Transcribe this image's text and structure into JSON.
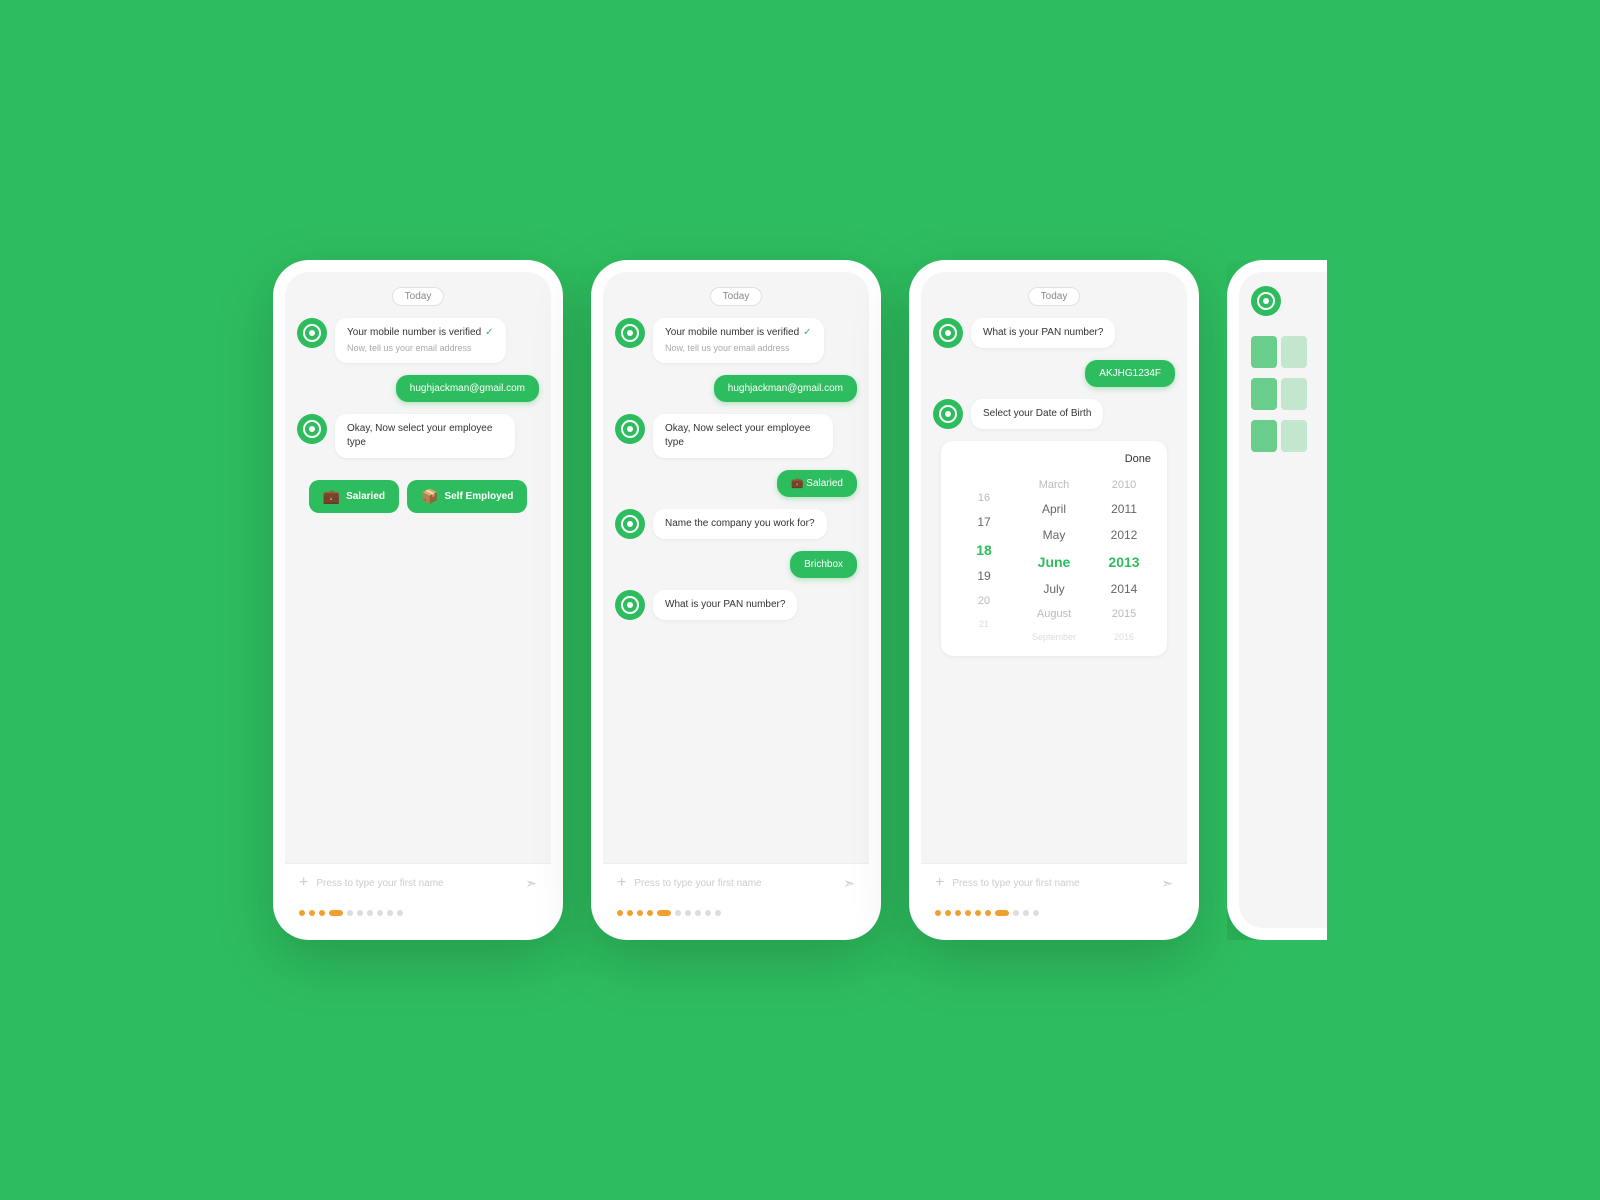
{
  "background_color": "#2EBD5E",
  "phones": [
    {
      "id": "phone-1",
      "today_label": "Today",
      "messages": [
        {
          "type": "bot",
          "text": "Your mobile number is verified",
          "subtext": "Now, tell us your email address",
          "verified": true
        },
        {
          "type": "user",
          "text": "hughjackman@gmail.com"
        },
        {
          "type": "bot",
          "text": "Okay, Now select your employee type"
        }
      ],
      "employee_buttons": [
        {
          "label": "Salaried",
          "icon": "💼"
        },
        {
          "label": "Self Employed",
          "icon": "📦"
        }
      ],
      "input_placeholder": "Press to type your first name",
      "progress_dots": [
        1,
        1,
        1,
        1,
        0,
        0,
        0,
        0,
        0,
        0,
        0
      ]
    },
    {
      "id": "phone-2",
      "today_label": "Today",
      "messages": [
        {
          "type": "bot",
          "text": "Your mobile number is verified",
          "subtext": "Now, tell us your email address",
          "verified": true
        },
        {
          "type": "user",
          "text": "hughjackman@gmail.com"
        },
        {
          "type": "bot",
          "text": "Okay, Now select your employee type"
        },
        {
          "type": "user",
          "text": "Salaried",
          "icon": "💼"
        },
        {
          "type": "bot",
          "text": "Name the company you work for?"
        },
        {
          "type": "user",
          "text": "Brichbox"
        },
        {
          "type": "bot",
          "text": "What is your PAN number?"
        }
      ],
      "input_placeholder": "Press to type your first name",
      "progress_dots": [
        1,
        1,
        1,
        1,
        1,
        0,
        0,
        0,
        0,
        0,
        0
      ]
    },
    {
      "id": "phone-3",
      "today_label": "Today",
      "messages": [
        {
          "type": "bot",
          "text": "What is your PAN number?"
        },
        {
          "type": "user",
          "text": "AKJHG1234F"
        },
        {
          "type": "bot",
          "text": "Select your Date of Birth"
        }
      ],
      "date_picker": {
        "done_label": "Done",
        "columns": [
          {
            "type": "day",
            "values": [
              "16",
              "17",
              "18",
              "19",
              "20",
              "21"
            ],
            "selected_index": 2
          },
          {
            "type": "month",
            "values": [
              "March",
              "April",
              "May",
              "June",
              "July",
              "August",
              "September"
            ],
            "selected_index": 3
          },
          {
            "type": "year",
            "values": [
              "2010",
              "2011",
              "2012",
              "2013",
              "2014",
              "2015",
              "2016"
            ],
            "selected_index": 3
          }
        ]
      },
      "input_placeholder": "Press to type your first name",
      "progress_dots": [
        1,
        1,
        1,
        1,
        1,
        1,
        0,
        0,
        0,
        0,
        0
      ]
    }
  ],
  "partial_phone": {
    "id": "phone-4-partial"
  }
}
